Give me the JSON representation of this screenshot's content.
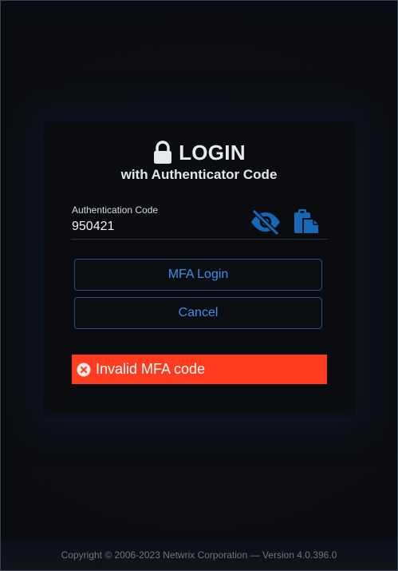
{
  "login": {
    "title": "LOGIN",
    "subtitle": "with Authenticator Code",
    "lock_icon": "lock-icon"
  },
  "auth_field": {
    "label": "Authentication Code",
    "value": "950421",
    "visibility_icon": "eye-slash-icon",
    "paste_icon": "clipboard-icon"
  },
  "buttons": {
    "mfa_login": "MFA Login",
    "cancel": "Cancel"
  },
  "error": {
    "message": "Invalid MFA code",
    "icon": "error-circle-icon"
  },
  "footer": {
    "copyright": "Copyright © 2006-2023 Netwrix Corporation — Version 4.0.396.0"
  },
  "colors": {
    "accent": "#3d8fe8",
    "icon_blue": "#1668b8",
    "error_bg": "#ff3b1f",
    "background": "#0a0c10"
  }
}
